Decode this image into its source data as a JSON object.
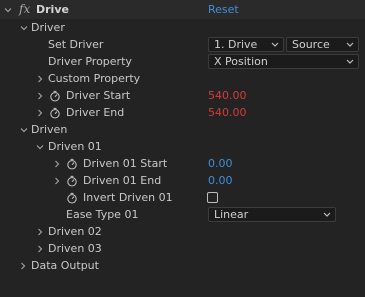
{
  "effect": {
    "name": "Drive",
    "fx_label": "fx",
    "reset_label": "Reset"
  },
  "driver_group": {
    "label": "Driver",
    "set_driver": {
      "label": "Set Driver",
      "driver_value": "1. Drive",
      "source_value": "Source"
    },
    "driver_property": {
      "label": "Driver Property",
      "value": "X Position"
    },
    "custom_property": {
      "label": "Custom Property"
    },
    "driver_start": {
      "label": "Driver Start",
      "value": "540.00"
    },
    "driver_end": {
      "label": "Driver End",
      "value": "540.00"
    }
  },
  "driven_group": {
    "label": "Driven",
    "driven_01": {
      "label": "Driven 01",
      "start": {
        "label": "Driven 01 Start",
        "value": "0.00"
      },
      "end": {
        "label": "Driven 01 End",
        "value": "0.00"
      },
      "invert": {
        "label": "Invert Driven 01",
        "checked": false
      },
      "ease_type": {
        "label": "Ease Type 01",
        "value": "Linear"
      }
    },
    "driven_02": {
      "label": "Driven 02"
    },
    "driven_03": {
      "label": "Driven 03"
    }
  },
  "data_output": {
    "label": "Data Output"
  },
  "colors": {
    "background": "#232323",
    "header_background": "#2a2a2a",
    "link_blue": "#3f8fdc",
    "value_red": "#d33b3b",
    "text": "#c9c9c9"
  },
  "icons": {
    "expanded": "chevron-down-icon",
    "collapsed": "chevron-right-icon",
    "stopwatch": "stopwatch-icon",
    "dropdown": "dropdown-arrow-icon"
  }
}
